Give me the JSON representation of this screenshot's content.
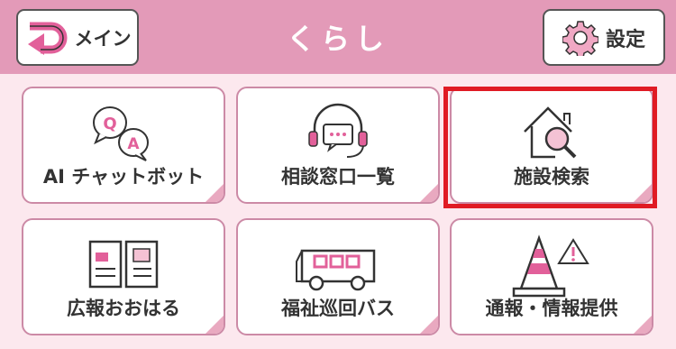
{
  "header": {
    "title": "くらし",
    "main_button_label": "メイン",
    "settings_button_label": "設定"
  },
  "tiles": [
    {
      "label": "AI チャットボット",
      "icon": "qa-chat-bubbles-icon"
    },
    {
      "label": "相談窓口一覧",
      "icon": "headset-chat-icon"
    },
    {
      "label": "施設検索",
      "icon": "house-magnifier-icon"
    },
    {
      "label": "広報おおはる",
      "icon": "open-magazine-icon"
    },
    {
      "label": "福祉巡回バス",
      "icon": "bus-icon"
    },
    {
      "label": "通報・情報提供",
      "icon": "traffic-cone-warning-icon"
    }
  ],
  "colors": {
    "header": "#e39ab8",
    "background": "#fce8ee",
    "tile_border": "#cc8aa6",
    "accent_pink": "#e9a9c0",
    "selection": "#e01b24"
  }
}
